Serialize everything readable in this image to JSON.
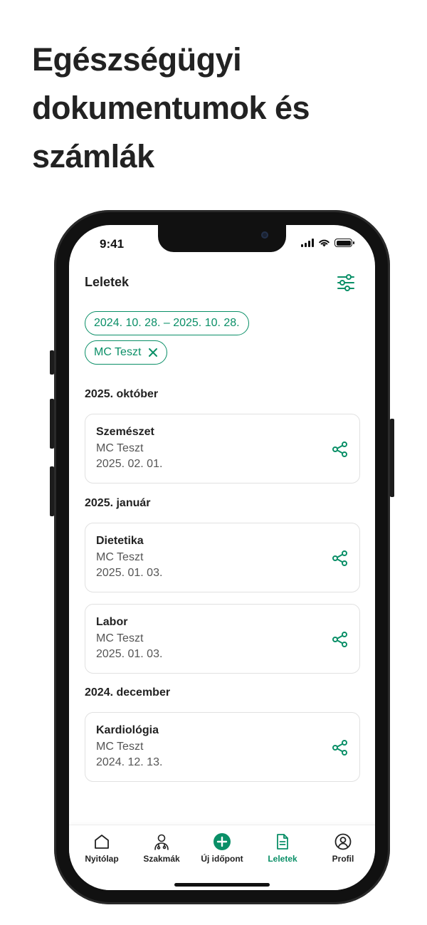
{
  "headline": [
    "Egészségügyi",
    "dokumentumok és",
    "számlák"
  ],
  "status": {
    "time": "9:41"
  },
  "header": {
    "title": "Leletek",
    "filter_icon": "sliders-icon"
  },
  "filters": {
    "date_range": "2024. 10. 28. – 2025. 10. 28.",
    "person": "MC Teszt"
  },
  "sections": [
    {
      "label": "2025. október"
    },
    {
      "label": "2025. január"
    },
    {
      "label": "2024. december"
    }
  ],
  "cards": [
    {
      "title": "Szemészet",
      "person": "MC Teszt",
      "date": "2025. 02. 01."
    },
    {
      "title": "Dietetika",
      "person": "MC Teszt",
      "date": "2025. 01. 03."
    },
    {
      "title": "Labor",
      "person": "MC Teszt",
      "date": "2025. 01. 03."
    },
    {
      "title": "Kardiológia",
      "person": "MC Teszt",
      "date": "2024. 12. 13."
    }
  ],
  "tabbar": [
    {
      "label": "Nyitólap",
      "icon": "home-icon"
    },
    {
      "label": "Szakmák",
      "icon": "doctor-icon"
    },
    {
      "label": "Új időpont",
      "icon": "plus-circle-icon"
    },
    {
      "label": "Leletek",
      "icon": "document-icon",
      "active": true
    },
    {
      "label": "Profil",
      "icon": "user-circle-icon"
    }
  ],
  "colors": {
    "accent": "#0a8f67",
    "text": "#222222",
    "muted": "#555555"
  }
}
